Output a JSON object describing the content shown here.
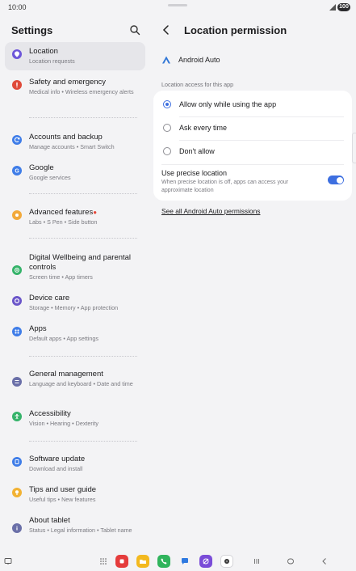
{
  "status": {
    "time": "10:00",
    "battery": "100"
  },
  "left": {
    "title": "Settings",
    "items": [
      {
        "title": "Location",
        "subtitle": "Location requests",
        "active": true,
        "color": "#6d56d9"
      },
      {
        "title": "Safety and emergency",
        "subtitle": "Medical info  •  Wireless emergency alerts",
        "color": "#df4a3a"
      },
      {
        "title": "Accounts and backup",
        "subtitle": "Manage accounts  •  Smart Switch",
        "color": "#3f7de8"
      },
      {
        "title": "Google",
        "subtitle": "Google services",
        "color": "#3f7de8"
      },
      {
        "title": "Advanced features",
        "subtitle": "Labs  •  S Pen  •  Side button",
        "color": "#f2a93b"
      },
      {
        "title": "Digital Wellbeing and parental controls",
        "subtitle": "Screen time  •  App timers",
        "color": "#35b36a"
      },
      {
        "title": "Device care",
        "subtitle": "Storage  •  Memory  •  App protection",
        "color": "#6a55c9"
      },
      {
        "title": "Apps",
        "subtitle": "Default apps  •  App settings",
        "color": "#3f7de8"
      },
      {
        "title": "General management",
        "subtitle": "Language and keyboard  •  Date and time",
        "color": "#6a6fa8"
      },
      {
        "title": "Accessibility",
        "subtitle": "Vision  •  Hearing  •  Dexterity",
        "color": "#35b36a"
      },
      {
        "title": "Software update",
        "subtitle": "Download and install",
        "color": "#3f7de8"
      },
      {
        "title": "Tips and user guide",
        "subtitle": "Useful tips  •  New features",
        "color": "#f2b233"
      },
      {
        "title": "About tablet",
        "subtitle": "Status  •  Legal information  •  Tablet name",
        "color": "#6a6fa8"
      }
    ]
  },
  "right": {
    "title": "Location permission",
    "app_name": "Android Auto",
    "section_label": "Location access for this app",
    "options": [
      {
        "label": "Allow only while using the app",
        "selected": true
      },
      {
        "label": "Ask every time",
        "selected": false
      },
      {
        "label": "Don't allow",
        "selected": false
      }
    ],
    "precise": {
      "title": "Use precise location",
      "description": "When precise location is off, apps can access your approximate location",
      "enabled": true
    },
    "see_all_link": "See all Android Auto permissions"
  },
  "accent_color": "#3d6fe0"
}
